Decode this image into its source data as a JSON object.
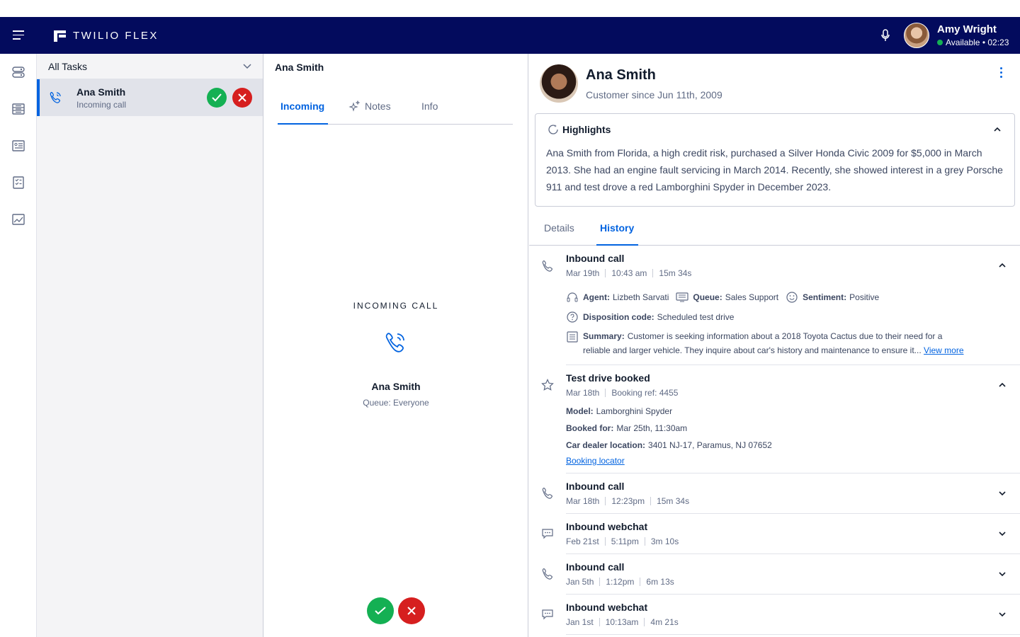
{
  "app": {
    "logo_text": "TWILIO FLEX"
  },
  "user": {
    "name": "Amy Wright",
    "status": "Available • 02:23"
  },
  "rail": {
    "icons": [
      "tasks-icon",
      "queues-icon",
      "directory-icon",
      "checklist-icon",
      "analytics-icon"
    ]
  },
  "tasklist": {
    "filter_label": "All Tasks",
    "task": {
      "name": "Ana Smith",
      "subtitle": "Incoming call"
    }
  },
  "center": {
    "title": "Ana Smith",
    "tabs": [
      {
        "label": "Incoming",
        "active": true
      },
      {
        "label": "Notes",
        "active": false
      },
      {
        "label": "Info",
        "active": false
      }
    ],
    "incoming_label": "INCOMING CALL",
    "caller_name": "Ana Smith",
    "caller_queue": "Queue: Everyone"
  },
  "profile": {
    "name": "Ana Smith",
    "since": "Customer since Jun 11th, 2009"
  },
  "highlights": {
    "title": "Highlights",
    "text": "Ana Smith from Florida, a high credit risk, purchased a Silver Honda Civic 2009 for $5,000 in March 2013. She had an engine fault servicing in March 2014. Recently, she showed interest in a grey Porsche 911 and test drove a red Lamborghini Spyder in December 2023."
  },
  "rtabs": [
    {
      "label": "Details",
      "active": false
    },
    {
      "label": "History",
      "active": true
    }
  ],
  "history": [
    {
      "title": "Inbound call",
      "date": "Mar 19th",
      "time": "10:43 am",
      "duration": "15m 34s",
      "agent_label": "Agent:",
      "agent": "Lizbeth Sarvati",
      "queue_label": "Queue:",
      "queue": "Sales Support",
      "sentiment_label": "Sentiment:",
      "sentiment": "Positive",
      "disposition_label": "Disposition code:",
      "disposition": "Scheduled test drive",
      "summary_label": "Summary:",
      "summary_line1": "Customer is seeking information about a 2018 Toyota Cactus due to their need for a",
      "summary_line2": "reliable and larger vehicle. They inquire about car's history and maintenance to ensure it...",
      "view_more": "View more"
    },
    {
      "title": "Test drive booked",
      "date": "Mar 18th",
      "ref": "Booking ref: 4455",
      "model_label": "Model:",
      "model": "Lamborghini Spyder",
      "booked_label": "Booked for:",
      "booked": "Mar 25th, 11:30am",
      "location_label": "Car dealer location:",
      "location": "3401 NJ-17, Paramus, NJ 07652",
      "locator": "Booking locator"
    },
    {
      "title": "Inbound call",
      "date": "Mar 18th",
      "time": "12:23pm",
      "duration": "15m 34s"
    },
    {
      "title": "Inbound webchat",
      "date": "Feb 21st",
      "time": "5:11pm",
      "duration": "3m 10s"
    },
    {
      "title": "Inbound call",
      "date": "Jan 5th",
      "time": "1:12pm",
      "duration": "6m 13s"
    },
    {
      "title": "Inbound webchat",
      "date": "Jan 1st",
      "time": "10:13am",
      "duration": "4m 21s"
    }
  ],
  "colors": {
    "nav": "#030b5d",
    "accent": "#0263e0",
    "accept": "#14b053",
    "reject": "#d61f1f"
  }
}
